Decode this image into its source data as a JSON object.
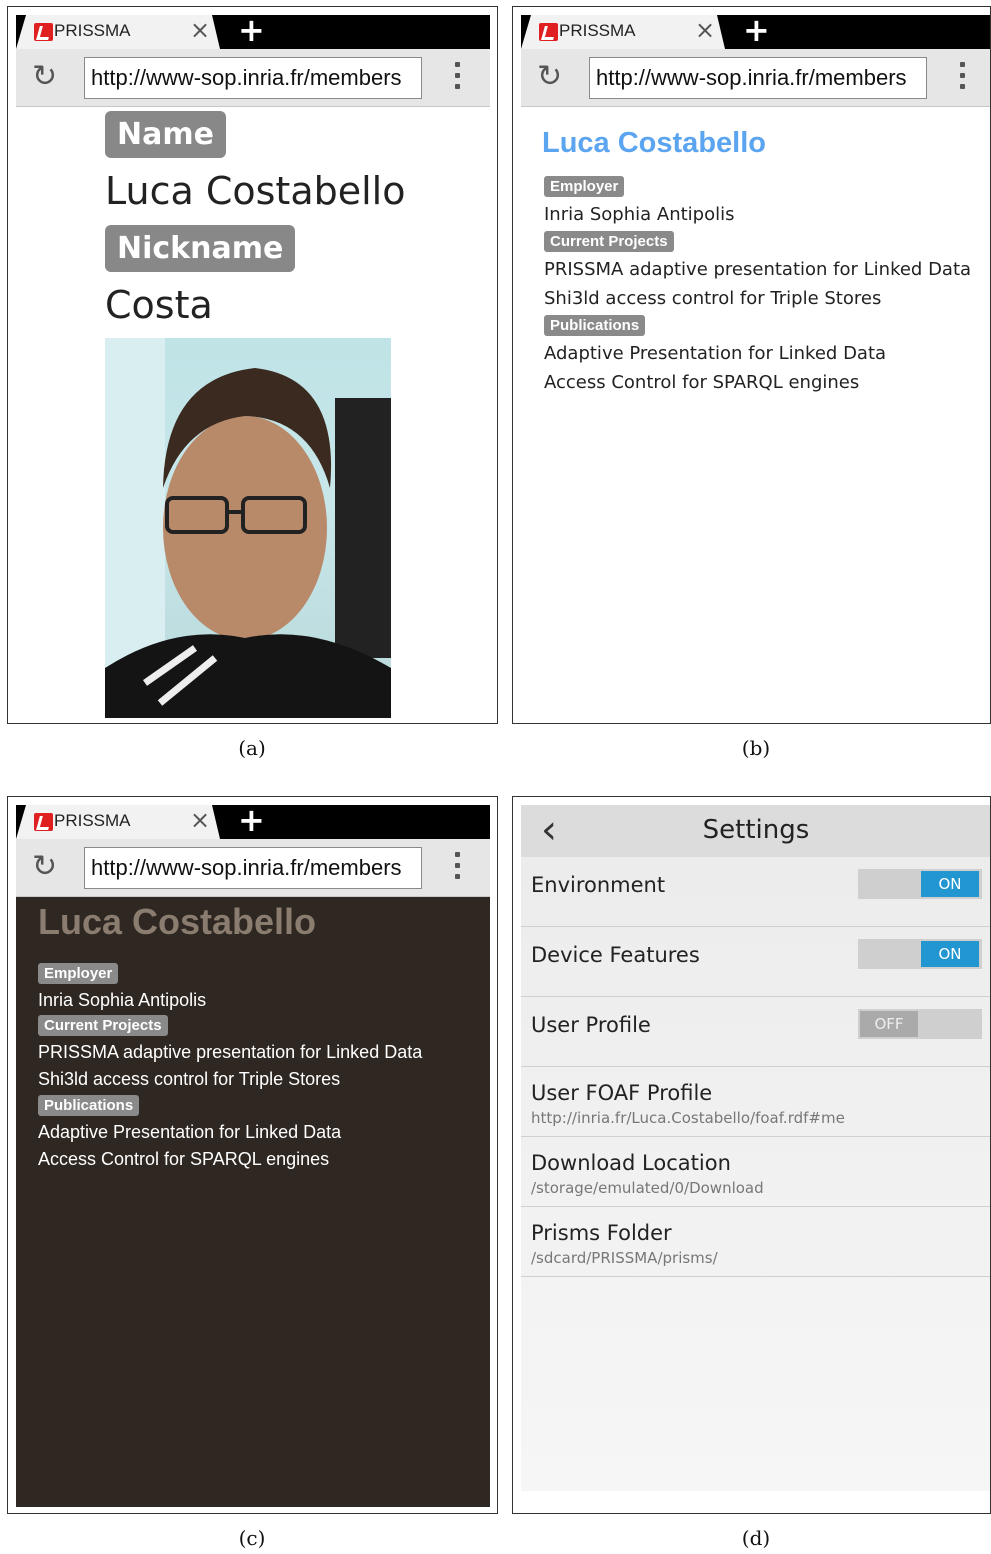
{
  "browser": {
    "tab_title": "PRISSMA",
    "close_glyph": "×",
    "new_tab_glyph": "+",
    "reload_glyph": "↻",
    "url": "http://www-sop.inria.fr/members"
  },
  "panel_a": {
    "caption": "(a)",
    "name_label": "Name",
    "name_value": "Luca Costabello",
    "nickname_label": "Nickname",
    "nickname_value": "Costa"
  },
  "profile": {
    "name": "Luca Costabello",
    "employer_label": "Employer",
    "employer_value": "Inria Sophia Antipolis",
    "projects_label": "Current Projects",
    "projects": [
      "PRISSMA adaptive presentation for Linked Data",
      "Shi3ld access control for Triple Stores"
    ],
    "publications_label": "Publications",
    "publications": [
      "Adaptive Presentation for Linked Data",
      "Access Control for SPARQL engines"
    ]
  },
  "panel_b": {
    "caption": "(b)",
    "name_color": "#5ba4f0"
  },
  "panel_c": {
    "caption": "(c)",
    "background": "#2f2721",
    "name_color": "#8a7d6f"
  },
  "panel_d": {
    "caption": "(d)",
    "back_glyph": "‹",
    "title": "Settings",
    "toggles": [
      {
        "label": "Environment",
        "state": "ON"
      },
      {
        "label": "Device Features",
        "state": "ON"
      },
      {
        "label": "User Profile",
        "state": "OFF"
      }
    ],
    "fields": [
      {
        "label": "User FOAF Profile",
        "value": "http://inria.fr/Luca.Costabello/foaf.rdf#me"
      },
      {
        "label": "Download Location",
        "value": "/storage/emulated/0/Download"
      },
      {
        "label": "Prisms Folder",
        "value": "/sdcard/PRISSMA/prisms/"
      }
    ],
    "toggle_on_color": "#2196d0"
  }
}
